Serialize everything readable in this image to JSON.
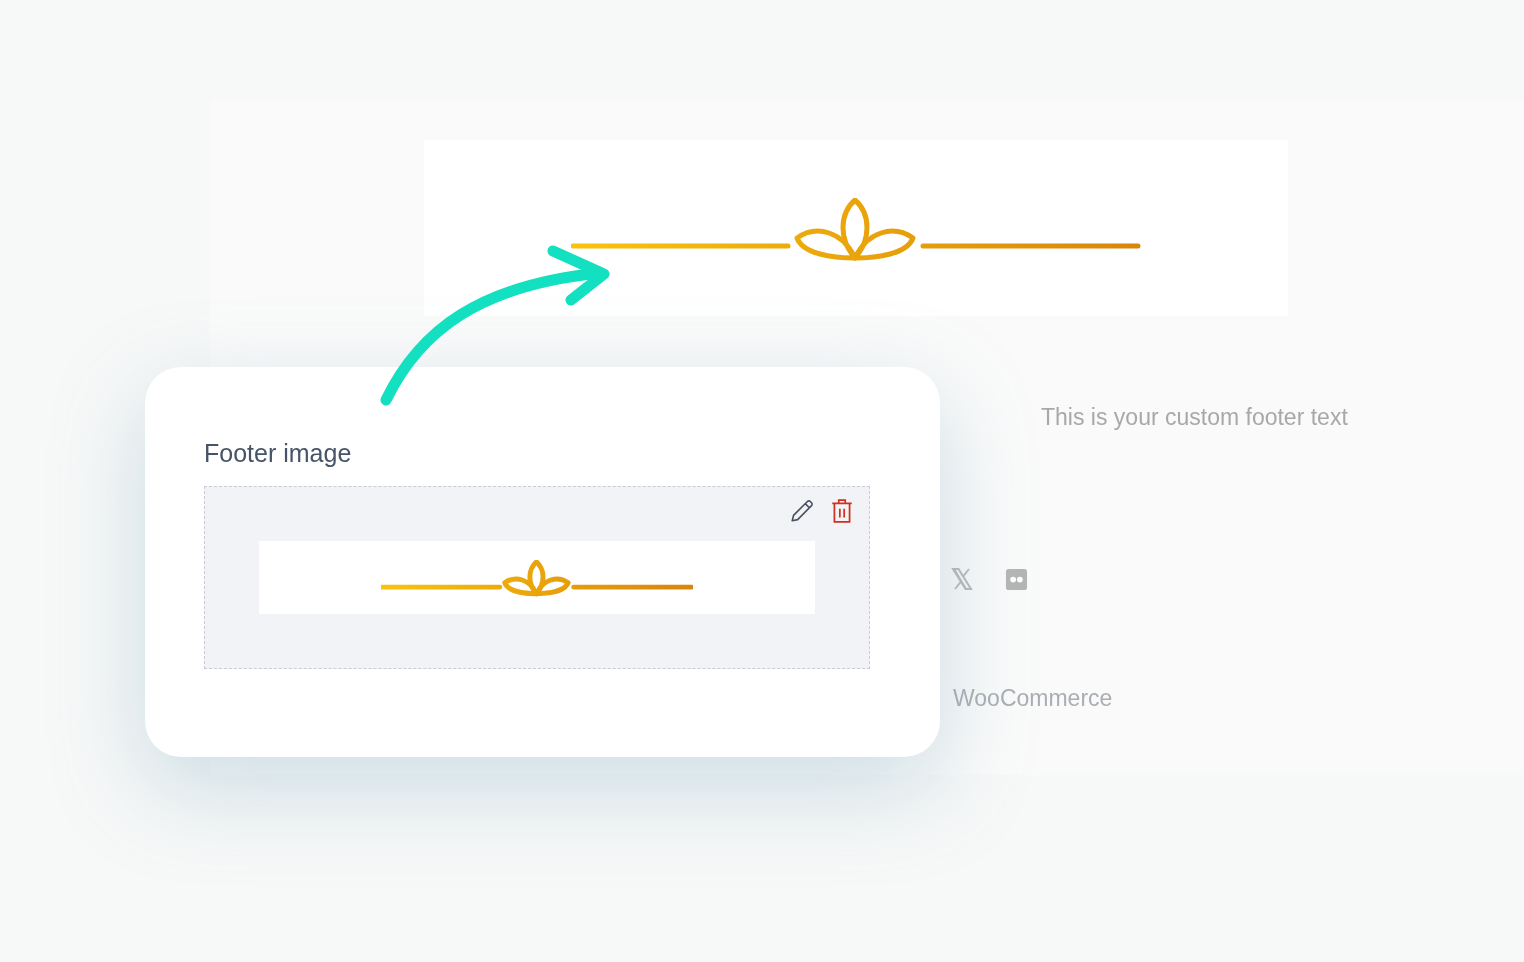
{
  "preview": {
    "footer_text": "This is your custom footer text",
    "credit": "WooCommerce"
  },
  "settings_card": {
    "label": "Footer image"
  }
}
